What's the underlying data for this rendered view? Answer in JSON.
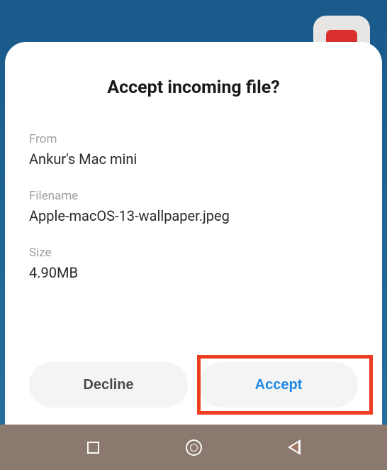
{
  "dialog": {
    "title": "Accept incoming file?",
    "from_label": "From",
    "from_value": "Ankur's Mac mini",
    "filename_label": "Filename",
    "filename_value": "Apple-macOS-13-wallpaper.jpeg",
    "size_label": "Size",
    "size_value": "4.90MB",
    "decline_label": "Decline",
    "accept_label": "Accept"
  }
}
